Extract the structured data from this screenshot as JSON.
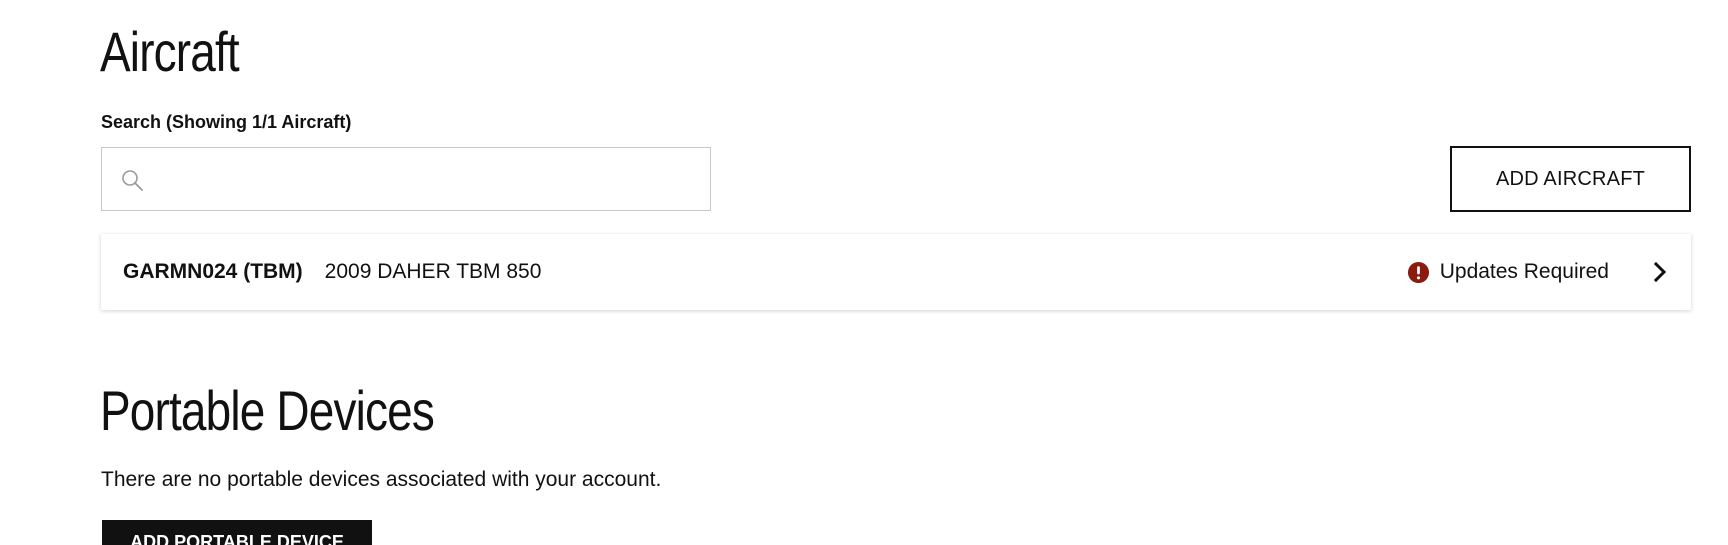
{
  "aircraft_section": {
    "title": "Aircraft",
    "search_label": "Search (Showing 1/1 Aircraft)",
    "search_value": "",
    "search_placeholder": "",
    "add_button_label": "ADD AIRCRAFT",
    "rows": [
      {
        "id": "GARMN024 (TBM)",
        "model": "2009 DAHER TBM 850",
        "status": "Updates Required",
        "status_icon": "alert-icon",
        "status_color": "#8b1a10"
      }
    ]
  },
  "portable_section": {
    "title": "Portable Devices",
    "empty_message": "There are no portable devices associated with your account.",
    "add_button_label": "ADD PORTABLE DEVICE"
  },
  "colors": {
    "text": "#111111",
    "border": "#c8c8c8",
    "alert": "#8b1a10",
    "primary_button_bg": "#111111"
  }
}
